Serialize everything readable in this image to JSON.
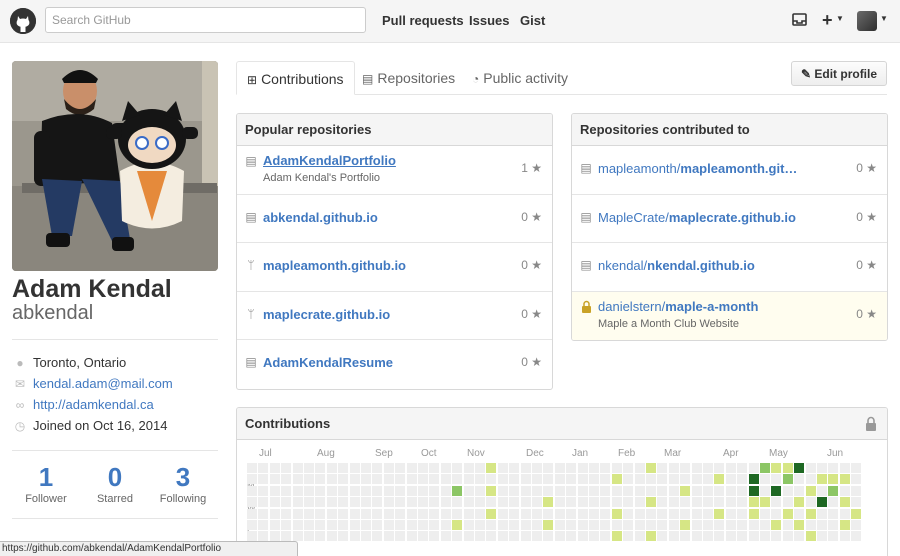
{
  "header": {
    "search_placeholder": "Search GitHub",
    "nav": [
      "Pull requests",
      "Issues",
      "Gist"
    ],
    "icons": [
      "github-logo",
      "inbox-icon",
      "plus-icon",
      "avatar"
    ]
  },
  "profile": {
    "fullname": "Adam Kendal",
    "username": "abkendal",
    "location": "Toronto, Ontario",
    "email": "kendal.adam@mail.com",
    "website": "http://adamkendal.ca",
    "joined": "Joined on Oct 16, 2014",
    "stats": [
      {
        "num": "1",
        "label": "Follower"
      },
      {
        "num": "0",
        "label": "Starred"
      },
      {
        "num": "3",
        "label": "Following"
      }
    ]
  },
  "tabs": [
    "Contributions",
    "Repositories",
    "Public activity"
  ],
  "edit_profile": "Edit profile",
  "popular": {
    "title": "Popular repositories",
    "repos": [
      {
        "name": "AdamKendalPortfolio",
        "desc": "Adam Kendal's Portfolio",
        "stars": "1",
        "icon": "repo-icon"
      },
      {
        "name": "abkendal.github.io",
        "desc": "",
        "stars": "0",
        "icon": "repo-icon"
      },
      {
        "name": "mapleamonth.github.io",
        "desc": "",
        "stars": "0",
        "icon": "fork-icon"
      },
      {
        "name": "maplecrate.github.io",
        "desc": "",
        "stars": "0",
        "icon": "fork-icon"
      },
      {
        "name": "AdamKendalResume",
        "desc": "",
        "stars": "0",
        "icon": "repo-icon"
      }
    ]
  },
  "contributed": {
    "title": "Repositories contributed to",
    "repos": [
      {
        "owner": "mapleamonth/",
        "name": "mapleamonth.git…",
        "desc": "",
        "stars": "0",
        "icon": "repo-icon"
      },
      {
        "owner": "MapleCrate/",
        "name": "maplecrate.github.io",
        "desc": "",
        "stars": "0",
        "icon": "repo-icon"
      },
      {
        "owner": "nkendal/",
        "name": "nkendal.github.io",
        "desc": "",
        "stars": "0",
        "icon": "repo-icon"
      },
      {
        "owner": "danielstern/",
        "name": "maple-a-month",
        "desc": "Maple a Month Club Website",
        "stars": "0",
        "icon": "lock-icon"
      }
    ]
  },
  "contributions": {
    "title": "Contributions",
    "months": [
      "Jul",
      "Aug",
      "Sep",
      "Oct",
      "Nov",
      "Dec",
      "Jan",
      "Feb",
      "Mar",
      "Apr",
      "May",
      "Jun"
    ],
    "days": [
      "M",
      "W",
      "F"
    ],
    "colors": [
      "#eeeeee",
      "#d6e685",
      "#8cc665",
      "#44a340",
      "#1e6823"
    ]
  },
  "status_url": "https://github.com/abkendal/AdamKendalPortfolio"
}
